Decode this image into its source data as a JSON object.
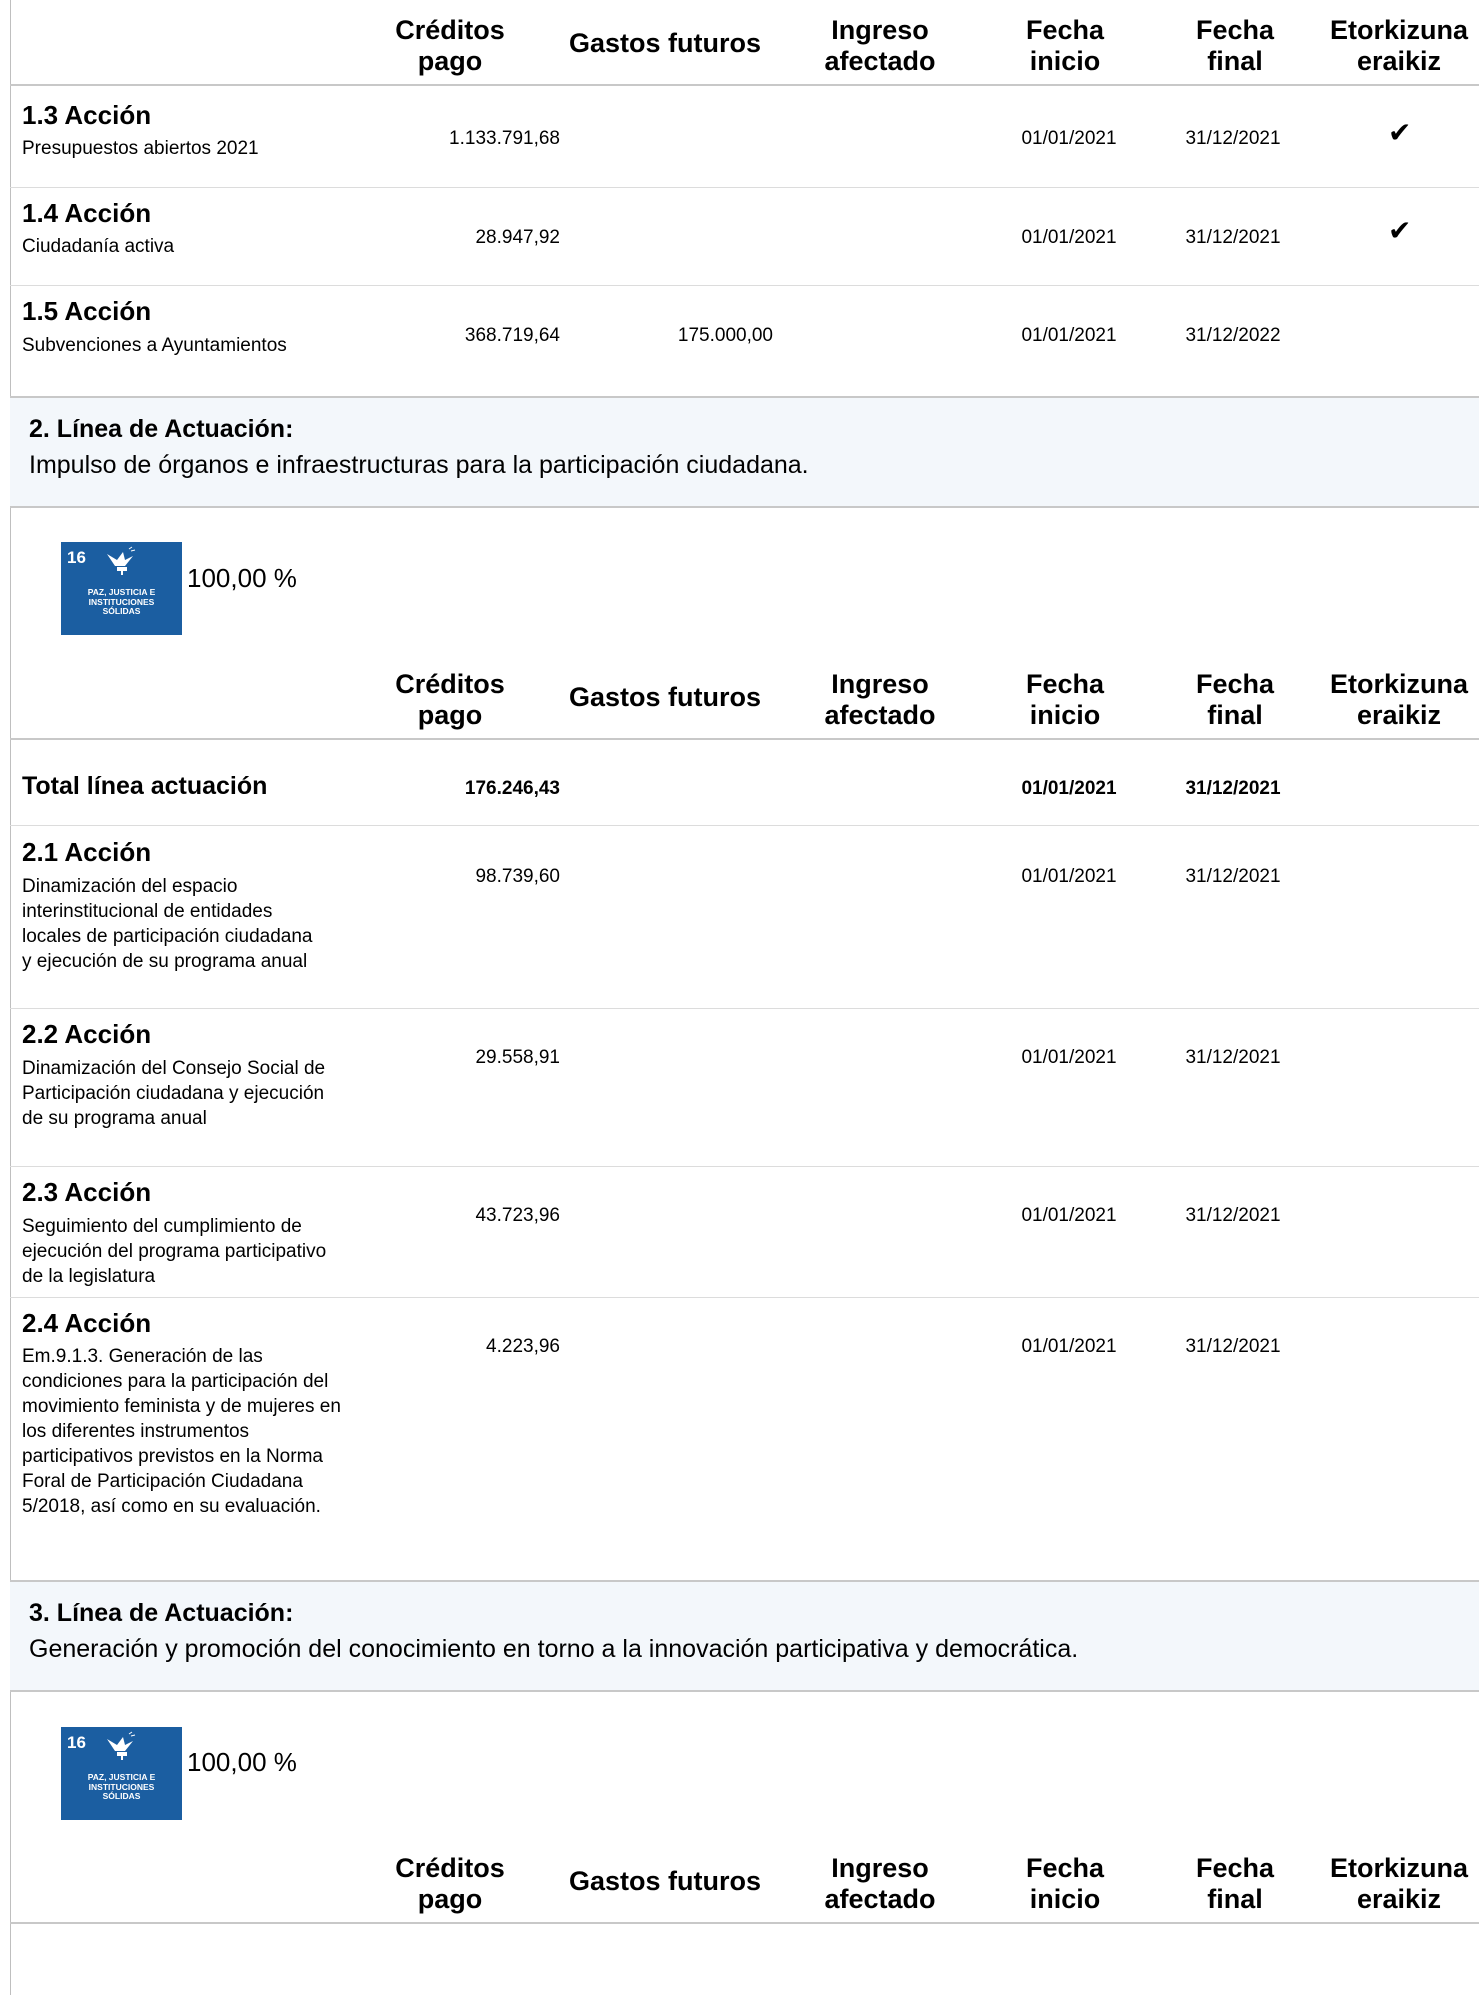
{
  "headers": {
    "creditos": "Créditos\npago",
    "gastos": "Gastos futuros",
    "ingreso": "Ingreso\nafectado",
    "fecha_inicio": "Fecha\ninicio",
    "fecha_final": "Fecha\nfinal",
    "etorkizuna": "Etorkizuna\neraikiz"
  },
  "actions_top": [
    {
      "title": "1.3 Acción",
      "desc": "Presupuestos abiertos 2021",
      "creditos": "1.133.791,68",
      "gastos": "",
      "inicio": "01/01/2021",
      "final": "31/12/2021",
      "check": "✔"
    },
    {
      "title": "1.4 Acción",
      "desc": "Ciudadanía activa",
      "creditos": "28.947,92",
      "gastos": "",
      "inicio": "01/01/2021",
      "final": "31/12/2021",
      "check": "✔"
    },
    {
      "title": "1.5 Acción",
      "desc": "Subvenciones a Ayuntamientos",
      "creditos": "368.719,64",
      "gastos": "175.000,00",
      "inicio": "01/01/2021",
      "final": "31/12/2022",
      "check": ""
    }
  ],
  "linea2": {
    "title": "2. Línea de Actuación:",
    "text": "Impulso de órganos e infraestructuras para la participación ciudadana.",
    "sdg_num": "16",
    "sdg_label": "PAZ, JUSTICIA E\nINSTITUCIONES\nSÓLIDAS",
    "pct": "100,00 %",
    "total_label": "Total línea actuación",
    "total_creditos": "176.246,43",
    "total_inicio": "01/01/2021",
    "total_final": "31/12/2021",
    "actions": [
      {
        "title": "2.1 Acción",
        "desc": "Dinamización del espacio interinstitucional de entidades locales de participación ciudadana y ejecución de su programa anual",
        "creditos": "98.739,60",
        "inicio": "01/01/2021",
        "final": "31/12/2021"
      },
      {
        "title": "2.2 Acción",
        "desc": "Dinamización del Consejo Social de Participación ciudadana y ejecución de su programa anual",
        "creditos": "29.558,91",
        "inicio": "01/01/2021",
        "final": "31/12/2021"
      },
      {
        "title": "2.3 Acción",
        "desc": "Seguimiento del cumplimiento de ejecución del programa participativo de la legislatura",
        "creditos": "43.723,96",
        "inicio": "01/01/2021",
        "final": "31/12/2021"
      },
      {
        "title": "2.4 Acción",
        "desc": "Em.9.1.3. Generación de las condiciones para la participación del movimiento feminista y de mujeres en los diferentes instrumentos participativos previstos en la Norma Foral de Participación Ciudadana  5/2018, así como en su  evaluación.",
        "creditos": "4.223,96",
        "inicio": "01/01/2021",
        "final": "31/12/2021"
      }
    ]
  },
  "linea3": {
    "title": "3. Línea de Actuación:",
    "text": "Generación y promoción del conocimiento en torno a la innovación participativa y democrática.",
    "sdg_num": "16",
    "sdg_label": "PAZ, JUSTICIA E\nINSTITUCIONES\nSÓLIDAS",
    "pct": "100,00 %"
  }
}
